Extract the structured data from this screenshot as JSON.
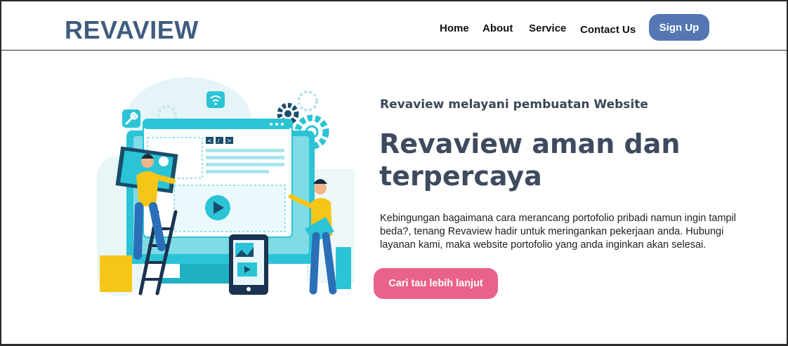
{
  "brand": {
    "logo": "REVAVIEW"
  },
  "nav": {
    "items": [
      {
        "label": "Home"
      },
      {
        "label": "About"
      },
      {
        "label": "Service"
      },
      {
        "label": "Contact Us"
      }
    ],
    "signup_label": "Sign Up"
  },
  "hero": {
    "subtitle": "Revaview melayani pembuatan Website",
    "title_line1": "Revaview aman dan",
    "title_line2": "terpercaya",
    "description": "Kebingungan bagaimana cara merancang portofolio pribadi namun ingin tampil beda?, tenang Revaview hadir untuk meringankan pekerjaan anda. Hubungi layanan kami, maka website portofolio yang anda inginkan akan selesai.",
    "cta_label": "Cari tau lebih lanjut"
  },
  "colors": {
    "logo": "#3f5c7f",
    "signup_button": "#5477b3",
    "cta_button": "#e9628a",
    "illustration_primary": "#2bc4d6",
    "illustration_accent": "#f5c518"
  },
  "icons": [
    "wifi-icon",
    "gear-icon",
    "wrench-icon",
    "play-icon",
    "code-brackets-icon",
    "image-icon"
  ]
}
